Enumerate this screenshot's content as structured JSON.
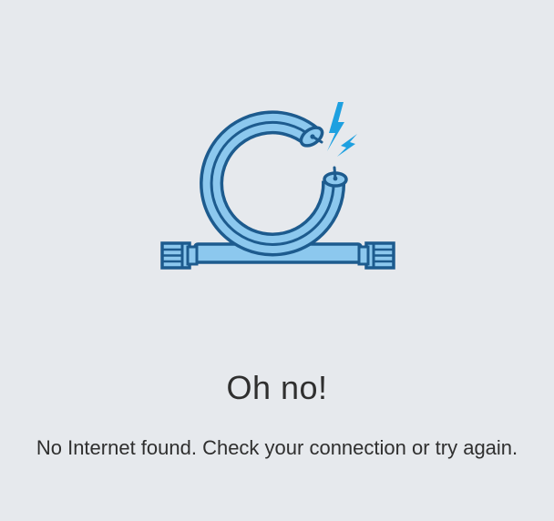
{
  "error": {
    "title": "Oh no!",
    "message": "No Internet found. Check your connection or try again."
  },
  "illustration": {
    "icon": "unplugged-cable-icon",
    "colors": {
      "outline": "#1d5b8e",
      "fill": "#8cc8ee",
      "spark": "#1ea0e0"
    }
  }
}
